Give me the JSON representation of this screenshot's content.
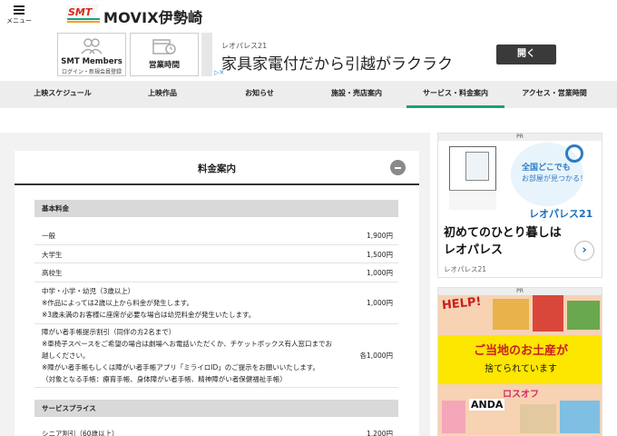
{
  "header": {
    "menu_label": "メニュー",
    "site_title": "MOVIX伊勢崎",
    "logo_text": "SMT"
  },
  "boxes": [
    {
      "title": "SMT Members",
      "subtitle": "ログイン・新規会員登録",
      "icon": "people-icon"
    },
    {
      "title": "営業時間",
      "icon": "calendar-clock-icon"
    }
  ],
  "top_ad": {
    "sub": "レオパレス21",
    "main": "家具家電付だから引越がラクラク",
    "button": "開く"
  },
  "nav": {
    "items": [
      {
        "label": "上映スケジュール"
      },
      {
        "label": "上映作品"
      },
      {
        "label": "お知らせ"
      },
      {
        "label": "施設・売店案内"
      },
      {
        "label": "サービス・料金案内",
        "active": true
      },
      {
        "label": "アクセス・営業時間"
      }
    ]
  },
  "pricing": {
    "title": "料金案内",
    "sections": [
      {
        "heading": "基本料金",
        "rows": [
          {
            "name": "一般",
            "price": "1,900円"
          },
          {
            "name": "大学生",
            "price": "1,500円"
          },
          {
            "name": "高校生",
            "price": "1,000円"
          },
          {
            "lines": [
              "中学・小学・幼児（3歳以上）",
              "※作品によっては2歳以上から料金が発生します。",
              "※3歳未満のお客様に座席が必要な場合は幼児料金が発生いたします。"
            ],
            "price": "1,000円"
          },
          {
            "lines": [
              "障がい者手帳提示割引（同伴の方2名まで）",
              "※車椅子スペースをご希望の場合は劇場へお電話いただくか、チケットボックス有人窓口までお",
              "越しください。",
              "※障がい者手帳もしくは障がい者手帳アプリ「ミライロID」のご提示をお願いいたします。",
              "（対象となる手帳：療育手帳、身体障がい者手帳、精神障がい者保健福祉手帳）"
            ],
            "price": "各1,000円"
          }
        ]
      },
      {
        "heading": "サービスプライス",
        "rows": [
          {
            "name": "シニア割引（60歳以上）",
            "price": "1,200円"
          }
        ]
      }
    ]
  },
  "side_ads": {
    "ad1": {
      "pr": "PR",
      "bubble_line1": "全国どこでも",
      "bubble_line2": "お部屋が見つかる！",
      "logo": "レオパレス21",
      "headline1": "初めてのひとり暮しは",
      "headline2": "レオパレス",
      "footer": "レオパレス21"
    },
    "ad2": {
      "pr": "PR",
      "help": "HELP!",
      "line1": "ご当地のお土産が",
      "line2": "捨てられています",
      "brand": "ロスオフ",
      "anda": "ANDA"
    }
  },
  "colors": {
    "accent": "#1aa17a",
    "nav_bg": "#ededed",
    "section_bg": "#d9d9d9"
  }
}
